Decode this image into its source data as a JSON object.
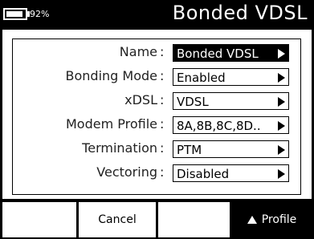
{
  "header": {
    "battery_percent_text": "92%",
    "battery_level": 0.92,
    "title": "Bonded VDSL"
  },
  "form": {
    "rows": [
      {
        "label": "Name",
        "value": "Bonded VDSL",
        "selected": true
      },
      {
        "label": "Bonding Mode",
        "value": "Enabled",
        "selected": false
      },
      {
        "label": "xDSL",
        "value": "VDSL",
        "selected": false
      },
      {
        "label": "Modem Profile",
        "value": "8A,8B,8C,8D..",
        "selected": false
      },
      {
        "label": "Termination",
        "value": "PTM",
        "selected": false
      },
      {
        "label": "Vectoring",
        "value": "Disabled",
        "selected": false
      }
    ],
    "colon": ":"
  },
  "softkeys": {
    "key1": "",
    "key2": "Cancel",
    "key3": "",
    "key4": "Profile"
  },
  "icons": {
    "battery": "battery-icon",
    "field_arrow": "right-triangle-icon",
    "profile_arrow": "up-triangle-icon"
  },
  "colors": {
    "background": "#000000",
    "panel": "#ffffff",
    "selected_field": "#000000"
  }
}
